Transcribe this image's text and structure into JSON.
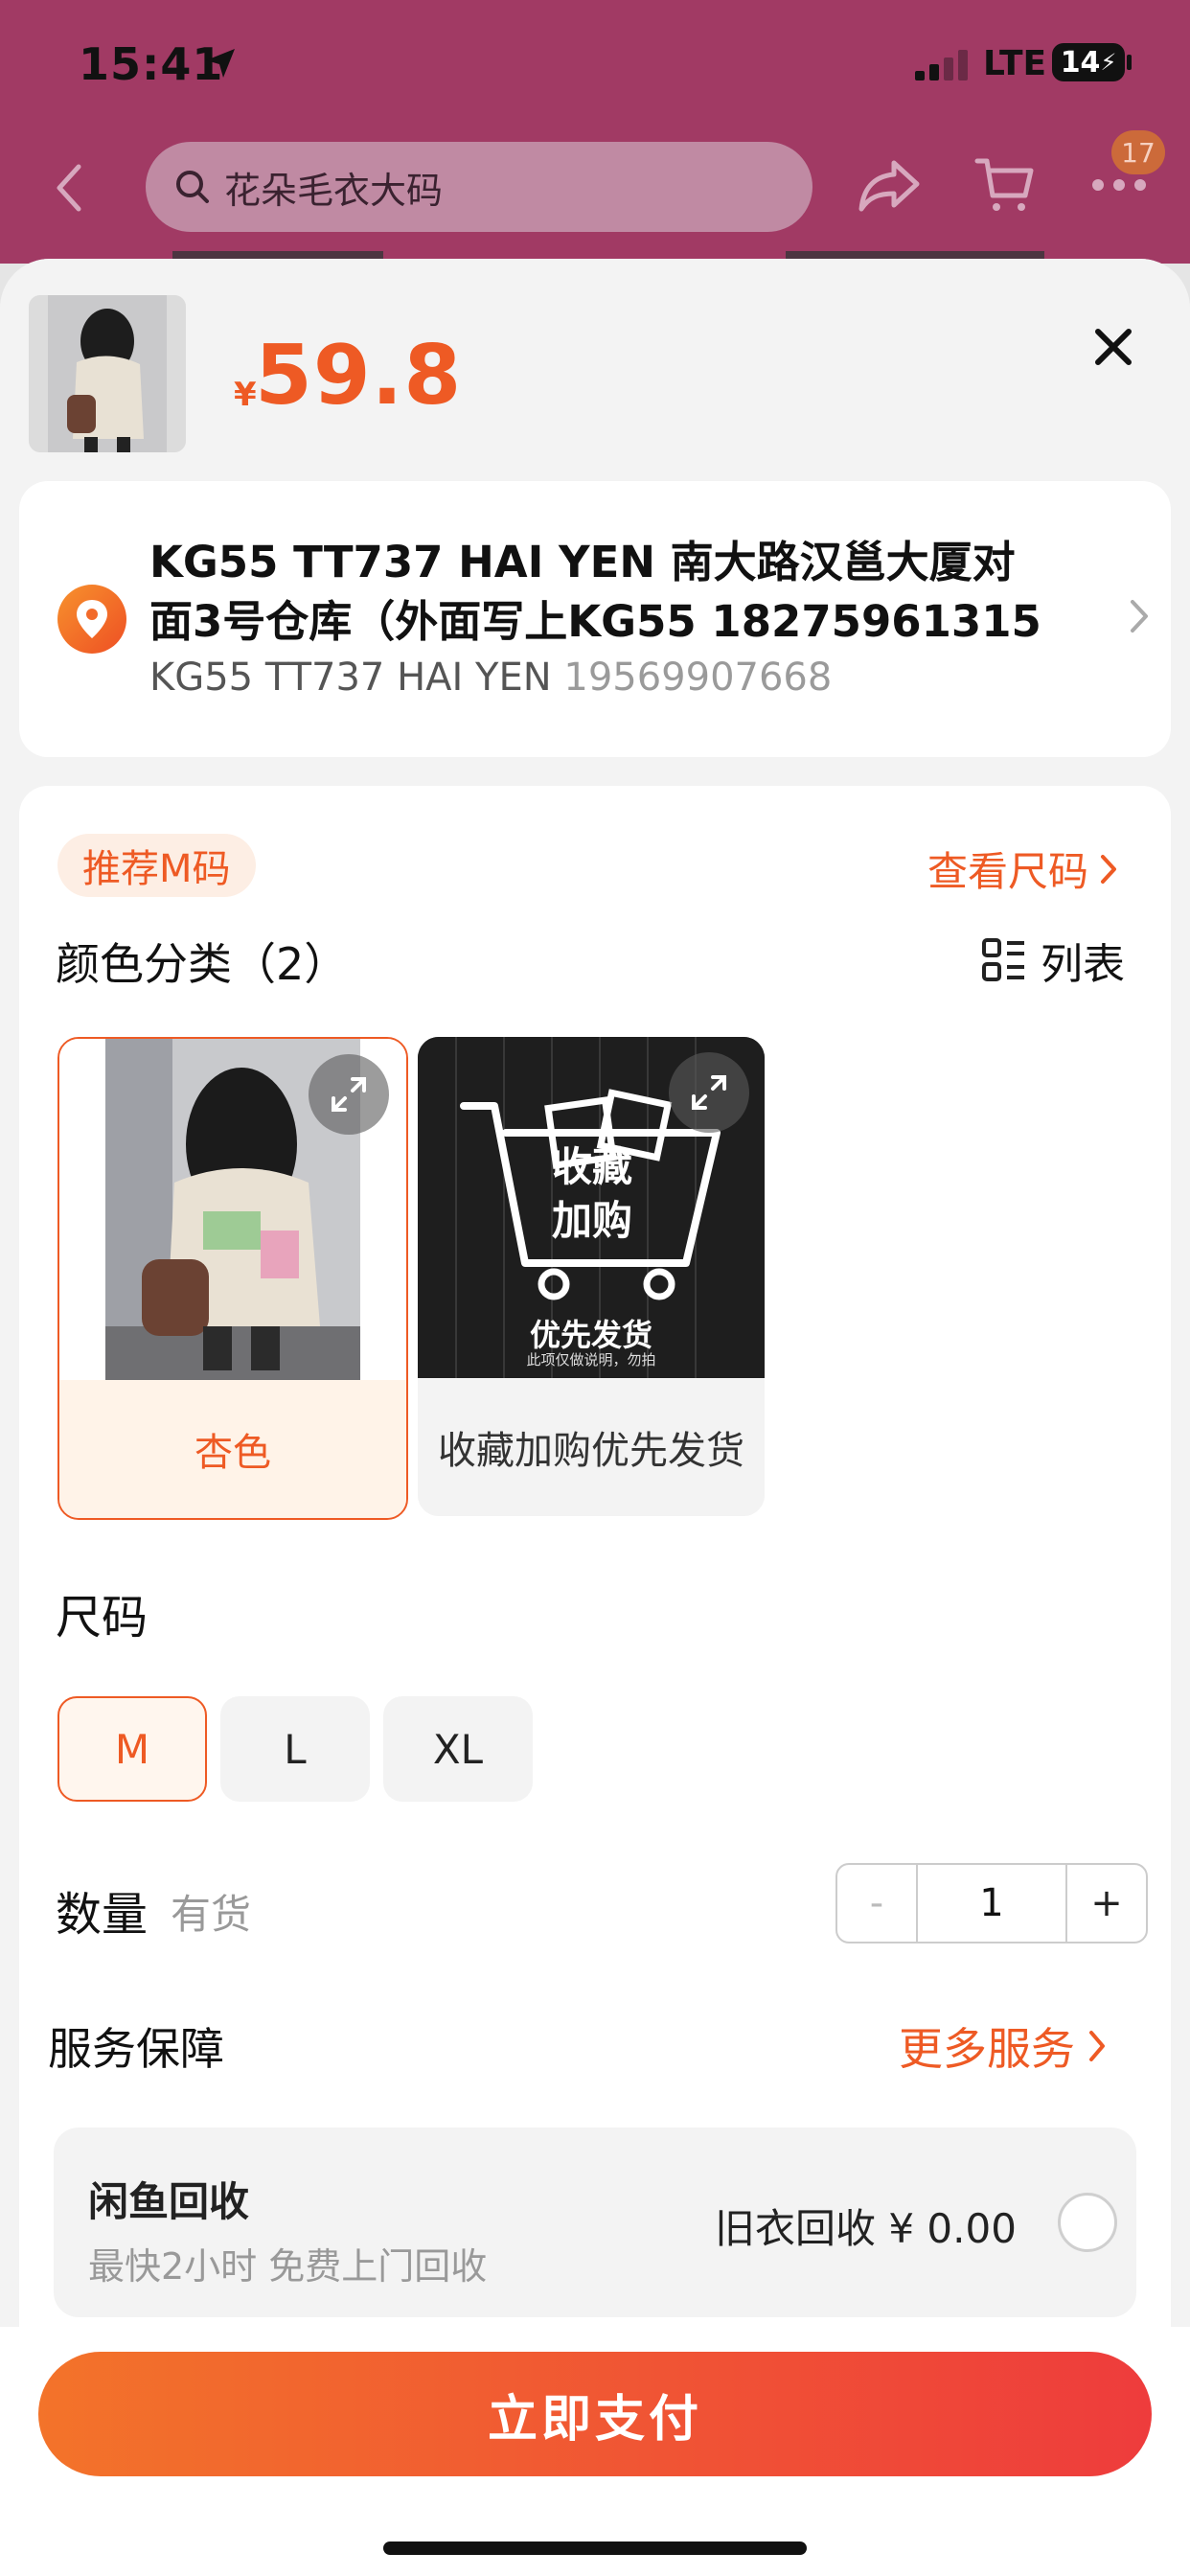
{
  "status": {
    "time": "15:41",
    "network": "LTE",
    "battery": "14"
  },
  "nav": {
    "search_placeholder": "花朵毛衣大码",
    "cart_badge": "17"
  },
  "sheet": {
    "currency": "¥",
    "price": "59.8"
  },
  "address": {
    "line1": "KG55 TT737 HAI YEN 南大路汉邕大厦对",
    "line2": "面3号仓库（外面写上KG55 18275961315",
    "contact_name": "KG55 TT737 HAI YEN",
    "contact_phone": "19569907668"
  },
  "sku": {
    "recommend_tag": "推荐M码",
    "size_chart_link": "查看尺码",
    "color_title": "颜色分类（2）",
    "list_toggle": "列表",
    "variants": [
      {
        "label": "杏色",
        "selected": true
      },
      {
        "label": "收藏加购优先发货",
        "selected": false,
        "image_text_1": "收藏",
        "image_text_2": "加购",
        "image_text_3": "优先发货",
        "image_text_4": "此项仅做说明，勿拍"
      }
    ],
    "size_title": "尺码",
    "sizes": [
      "M",
      "L",
      "XL"
    ],
    "selected_size": "M",
    "qty_title": "数量",
    "qty_stock": "有货",
    "qty_minus": "-",
    "qty_value": "1",
    "qty_plus": "+"
  },
  "service": {
    "title": "服务保障",
    "more": "更多服务",
    "recycle_title": "闲鱼回收",
    "recycle_sub": "最快2小时 免费上门回收",
    "recycle_value": "旧衣回收 ¥ 0.00"
  },
  "footer": {
    "pay_label": "立即支付"
  },
  "colors": {
    "accent": "#ee5a24",
    "header_bg": "#a13a64",
    "pay_gradient_start": "#f3732a",
    "pay_gradient_end": "#ee3c3c"
  }
}
